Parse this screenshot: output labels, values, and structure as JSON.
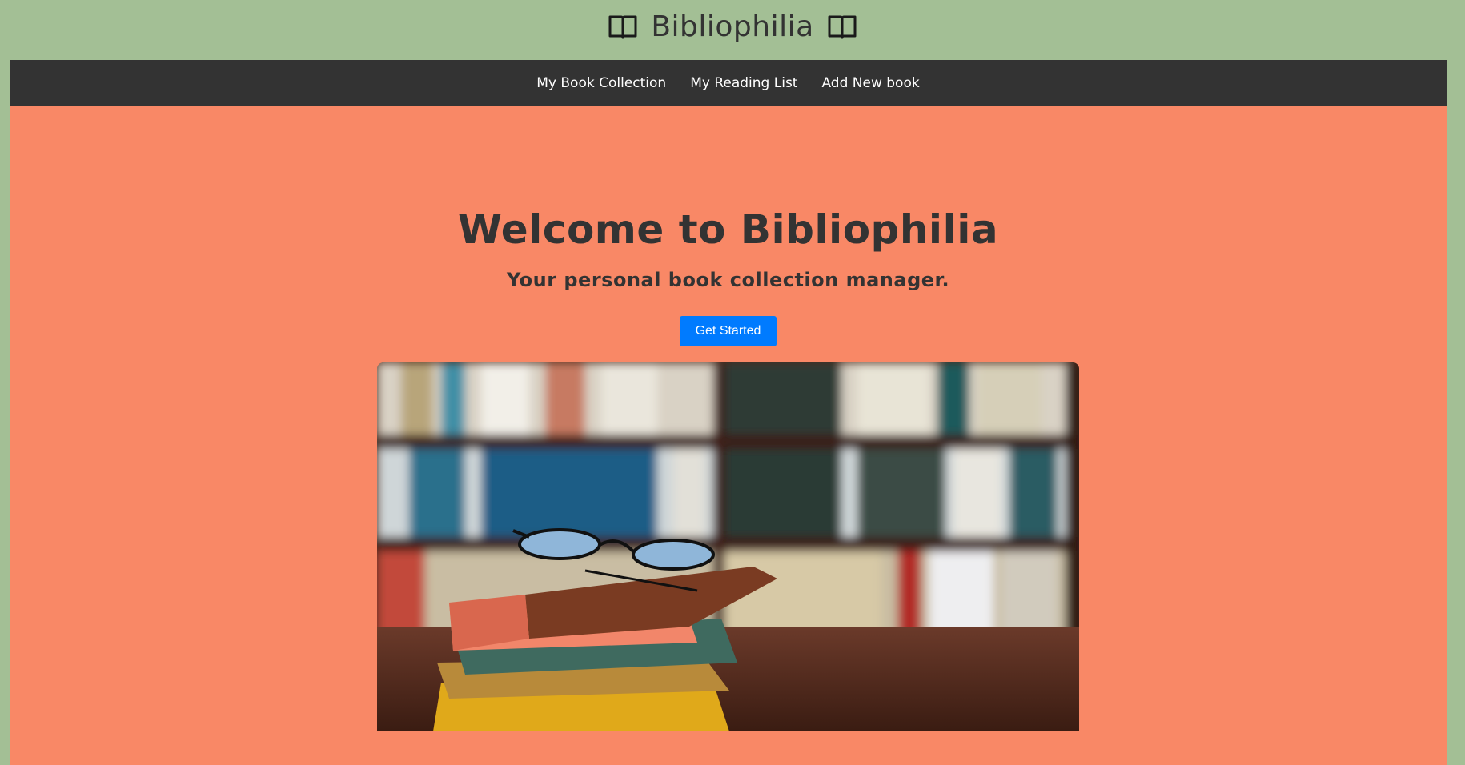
{
  "header": {
    "title": "Bibliophilia",
    "left_icon": "open-book-icon",
    "right_icon": "open-book-icon"
  },
  "nav": {
    "items": [
      {
        "label": "My Book Collection"
      },
      {
        "label": "My Reading List"
      },
      {
        "label": "Add New book"
      }
    ]
  },
  "hero": {
    "title": "Welcome to Bibliophilia",
    "subtitle": "Your personal book collection manager.",
    "cta_label": "Get Started"
  },
  "colors": {
    "page_background": "#a3bf95",
    "navbar": "#333333",
    "hero_background": "#f98866",
    "button": "#007bff",
    "text": "#333333"
  }
}
